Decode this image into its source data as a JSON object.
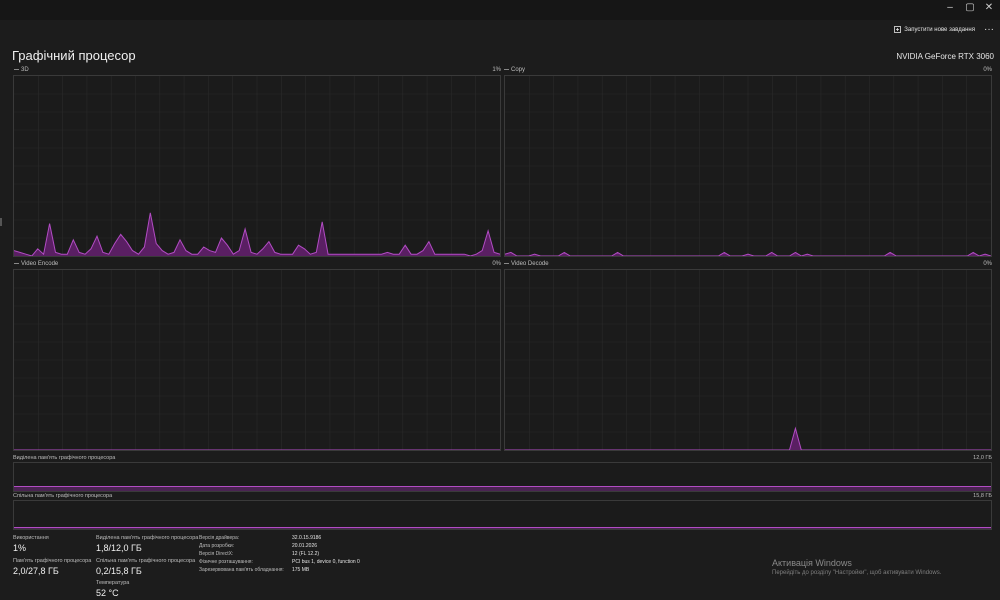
{
  "toolbar": {
    "run_task_label": "Запустити нове завдання",
    "more_label": "···"
  },
  "window_controls": {
    "minimize": "–",
    "maximize": "▢",
    "close": "✕"
  },
  "header": {
    "title": "Графічний процесор",
    "gpu_name": "NVIDIA GeForce RTX 3060"
  },
  "colors": {
    "accent": "#b24cc4",
    "fill": "#5a1f63",
    "grid": "#2a2a2a"
  },
  "graphs": [
    {
      "label": "3D",
      "value": "1%",
      "points": [
        3,
        2,
        1,
        0,
        4,
        1,
        18,
        2,
        1,
        1,
        9,
        2,
        1,
        4,
        11,
        2,
        1,
        7,
        12,
        8,
        3,
        1,
        5,
        24,
        7,
        3,
        1,
        2,
        9,
        3,
        1,
        1,
        5,
        3,
        2,
        10,
        6,
        1,
        3,
        15,
        2,
        1,
        4,
        8,
        2,
        1,
        1,
        1,
        6,
        4,
        1,
        2,
        19,
        1,
        1,
        1,
        1,
        1,
        1,
        1,
        1,
        1,
        1,
        2,
        1,
        1,
        6,
        1,
        1,
        3,
        8,
        1,
        1,
        1,
        1,
        1,
        1,
        0,
        1,
        3,
        14,
        2,
        1
      ]
    },
    {
      "label": "Copy",
      "value": "0%",
      "points": [
        1,
        2,
        0,
        0,
        0,
        1,
        0,
        0,
        0,
        0,
        2,
        0,
        0,
        0,
        0,
        0,
        0,
        0,
        0,
        2,
        0,
        0,
        0,
        0,
        0,
        0,
        0,
        0,
        0,
        0,
        0,
        0,
        0,
        0,
        0,
        0,
        0,
        2,
        0,
        0,
        0,
        1,
        0,
        0,
        0,
        2,
        0,
        0,
        0,
        2,
        0,
        1,
        0,
        0,
        0,
        0,
        0,
        0,
        0,
        0,
        0,
        0,
        0,
        0,
        0,
        2,
        0,
        0,
        0,
        0,
        0,
        0,
        0,
        0,
        0,
        0,
        0,
        0,
        0,
        2,
        0,
        1,
        0
      ]
    },
    {
      "label": "Video Encode",
      "value": "0%",
      "points": [
        0,
        0,
        0,
        0,
        0,
        0,
        0,
        0,
        0,
        0,
        0,
        0,
        0,
        0,
        0,
        0,
        0,
        0,
        0,
        0,
        0,
        0,
        0,
        0,
        0,
        0,
        0,
        0,
        0,
        0,
        0,
        0,
        0,
        0,
        0,
        0,
        0,
        0,
        0,
        0,
        0,
        0,
        0,
        0,
        0,
        0,
        0,
        0,
        0,
        0,
        0,
        0,
        0,
        0,
        0,
        0,
        0,
        0,
        0,
        0,
        0,
        0,
        0,
        0,
        0,
        0,
        0,
        0,
        0,
        0,
        0,
        0,
        0,
        0,
        0,
        0,
        0,
        0,
        0,
        0,
        0,
        0,
        0
      ]
    },
    {
      "label": "Video Decode",
      "value": "0%",
      "points": [
        0,
        0,
        0,
        0,
        0,
        0,
        0,
        0,
        0,
        0,
        0,
        0,
        0,
        0,
        0,
        0,
        0,
        0,
        0,
        0,
        0,
        0,
        0,
        0,
        0,
        0,
        0,
        0,
        0,
        0,
        0,
        0,
        0,
        0,
        0,
        0,
        0,
        0,
        0,
        0,
        0,
        0,
        0,
        0,
        0,
        0,
        0,
        0,
        0,
        12,
        0,
        0,
        0,
        0,
        0,
        0,
        0,
        0,
        0,
        0,
        0,
        0,
        0,
        0,
        0,
        0,
        0,
        0,
        0,
        0,
        0,
        0,
        0,
        0,
        0,
        0,
        0,
        0,
        0,
        0,
        0,
        0,
        0
      ]
    }
  ],
  "memory": [
    {
      "label": "Виділена пам'ять графічного процесора",
      "max": "12,0 ГБ",
      "fill_fraction": 0.15
    },
    {
      "label": "Спільна пам'ять графічного процесора",
      "max": "15,8 ГБ",
      "fill_fraction": 0.02
    }
  ],
  "stats": {
    "usage": {
      "label": "Використання",
      "value": "1%"
    },
    "gpu_memory": {
      "label": "Пам'ять графічного процесора",
      "value": "2,0/27,8 ГБ"
    },
    "dedicated": {
      "label": "Виділена пам'ять графічного процесора",
      "value": "1,8/12,0 ГБ"
    },
    "shared": {
      "label": "Спільна пам'ять графічного процесора",
      "value": "0,2/15,8 ГБ"
    },
    "temperature": {
      "label": "Температура",
      "value": "52 °C"
    }
  },
  "info": [
    {
      "key": "Версія драйвера:",
      "value": "32.0.15.9186"
    },
    {
      "key": "Дата розробки:",
      "value": "20.01.2026"
    },
    {
      "key": "Версія DirectX:",
      "value": "12 (FL 12.2)"
    },
    {
      "key": "Фізичне розташування:",
      "value": "PCI bus 1, device 0, function 0"
    },
    {
      "key": "Зарезервована пам'ять обладнання:",
      "value": "175 MB"
    }
  ],
  "watermark": {
    "title": "Активація Windows",
    "subtitle": "Перейдіть до розділу \"Настройки\", щоб активувати Windows."
  }
}
